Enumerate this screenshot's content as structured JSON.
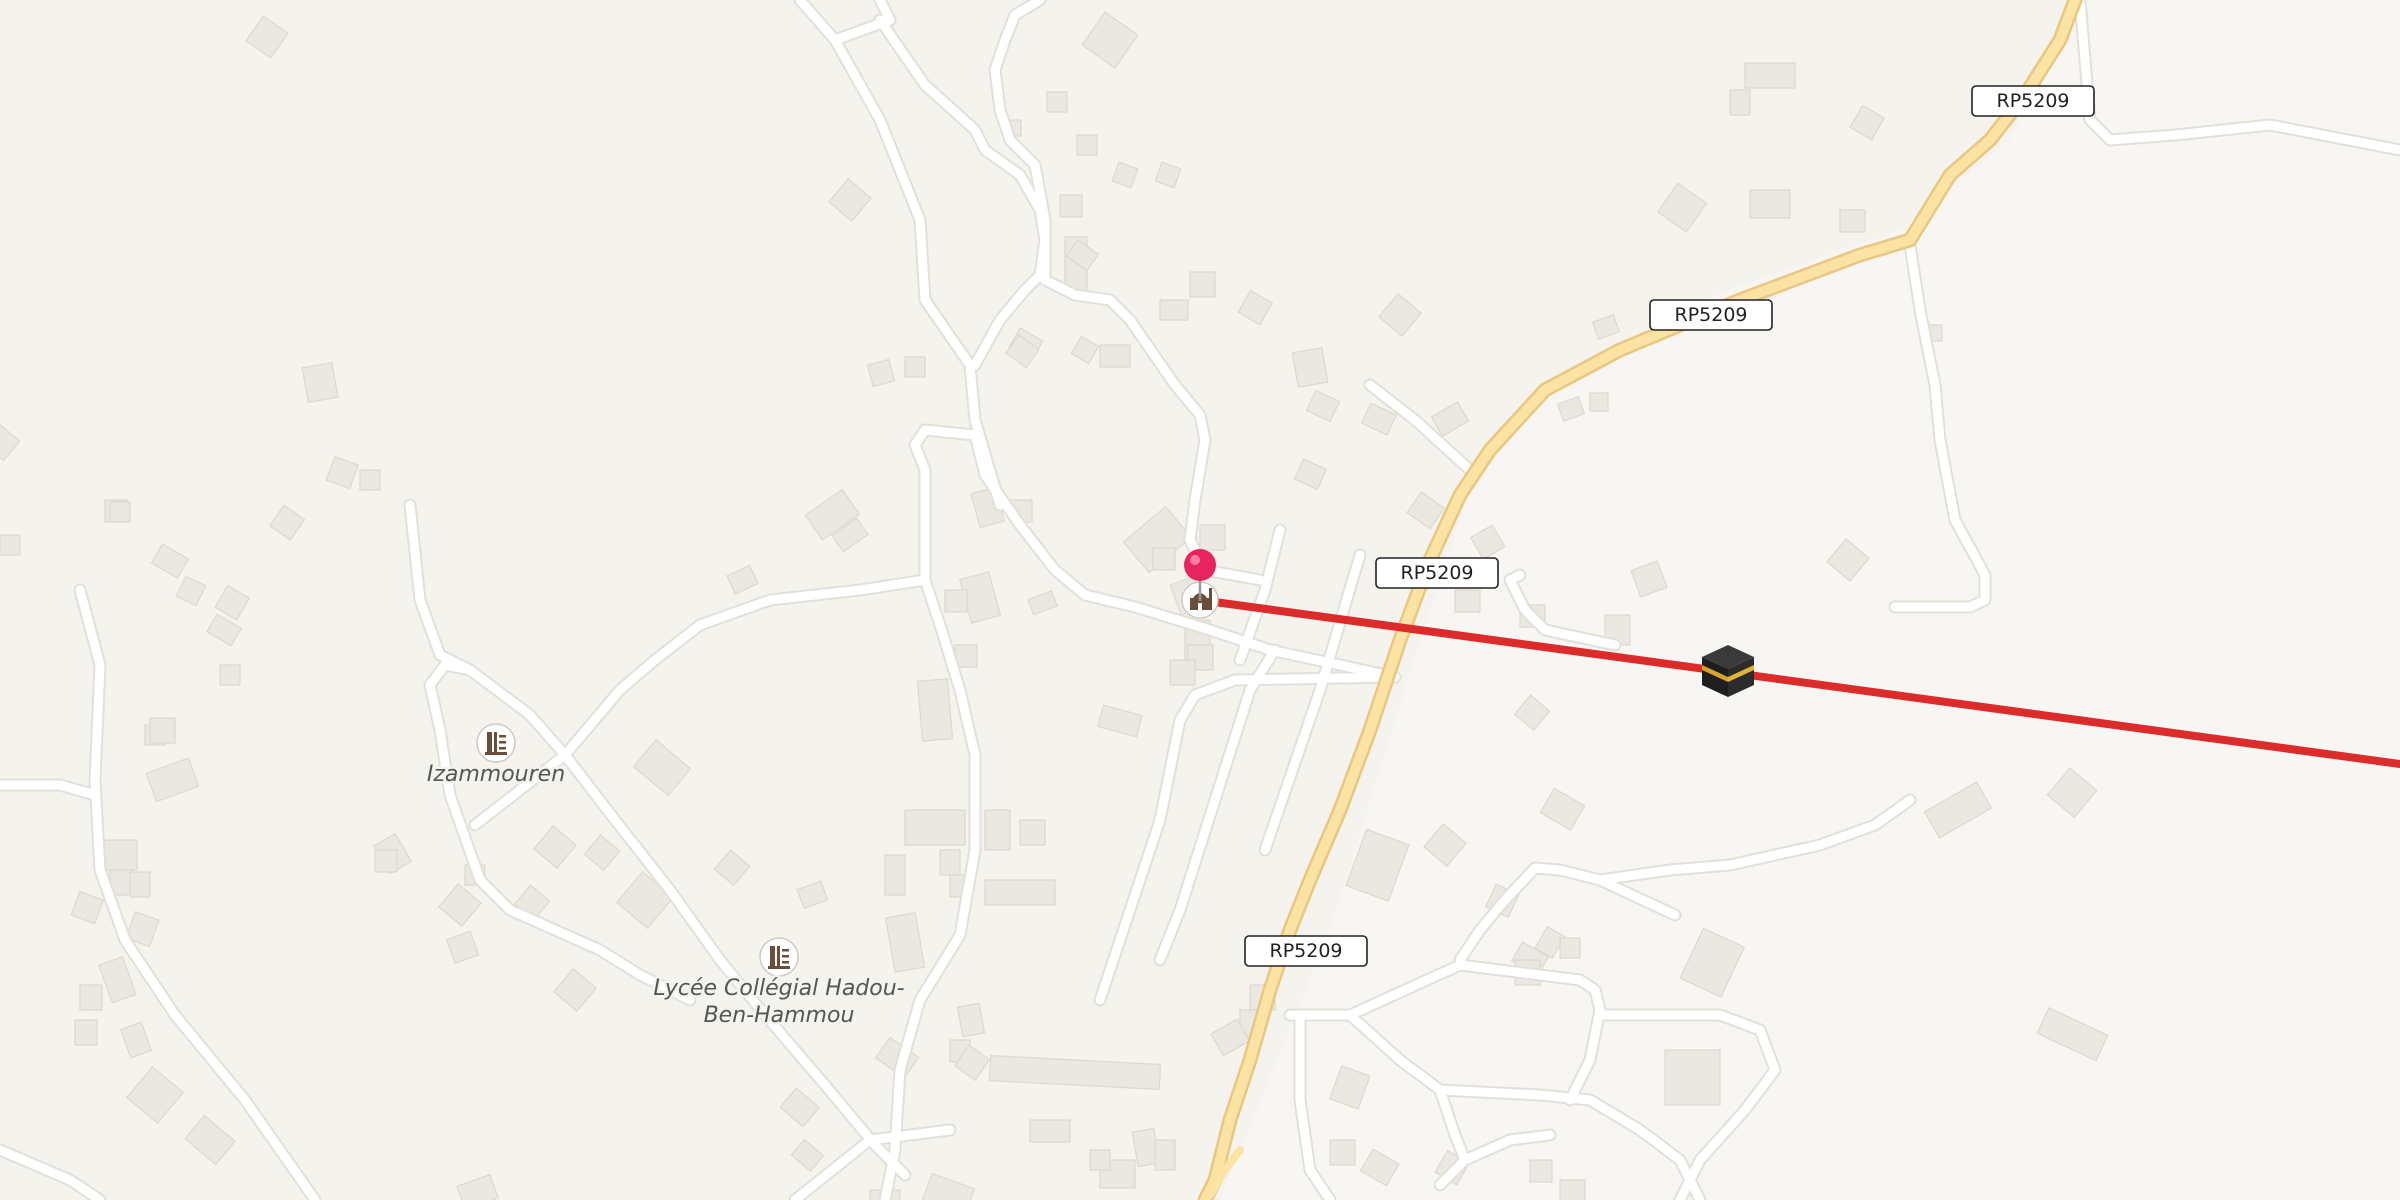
{
  "map": {
    "colors": {
      "background": "#f4f3ee",
      "land_east": "#f8f6f2",
      "road_minor": "#ffffff",
      "road_minor_casing": "#e2e0da",
      "road_primary": "#fbe3a3",
      "road_primary_casing": "#e9c681",
      "building": "#ebe7e1",
      "building_edge": "#ddd8d0",
      "qibla_line": "#dc2b2b",
      "pin": "#e8245c"
    },
    "road_shields": [
      {
        "id": "rp5209-ne",
        "ref": "RP5209"
      },
      {
        "id": "rp5209-mid",
        "ref": "RP5209"
      },
      {
        "id": "rp5209-center",
        "ref": "RP5209"
      },
      {
        "id": "rp5209-south",
        "ref": "RP5209"
      }
    ],
    "places": [
      {
        "id": "izammouren",
        "name": "Izammouren",
        "icon": "school-icon"
      },
      {
        "id": "lycee",
        "name_line1": "Lycée Collégial Hadou-",
        "name_line2": "Ben-Hammou",
        "icon": "school-icon"
      }
    ],
    "markers": {
      "location_pin": {
        "icon": "map-pin-icon"
      },
      "mosque": {
        "icon": "mosque-icon"
      },
      "qibla_direction": {
        "icon": "kaaba-icon"
      }
    }
  }
}
